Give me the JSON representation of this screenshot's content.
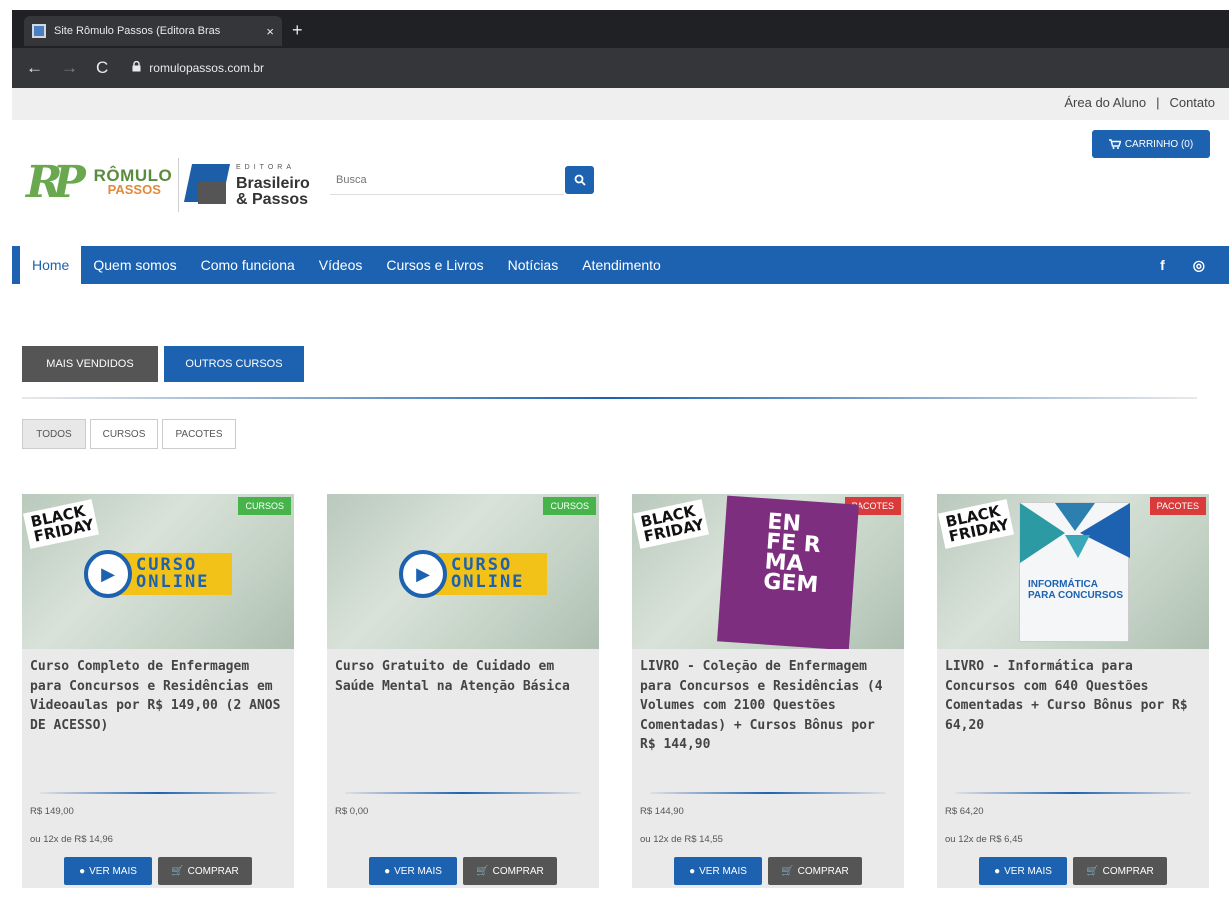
{
  "browser": {
    "tab_title": "Site Rômulo Passos (Editora Bras",
    "tab_close": "×",
    "new_tab": "+",
    "back": "←",
    "forward": "→",
    "reload": "C",
    "url": "romulopassos.com.br"
  },
  "toplinks": {
    "area": "Área do Aluno",
    "separator": "|",
    "contato": "Contato"
  },
  "header": {
    "logo_rr": "RP",
    "logo_name": "RÔMULO",
    "logo_sub": "PASSOS",
    "editora_top": "EDITORA",
    "editora_name1": "Brasileiro",
    "editora_name2": "& Passos",
    "search_placeholder": "Busca",
    "cart_label": "CARRINHO (0)"
  },
  "nav": {
    "items": [
      "Home",
      "Quem somos",
      "Como funciona",
      "Vídeos",
      "Cursos e Livros",
      "Notícias",
      "Atendimento"
    ],
    "facebook": "f",
    "instagram": "◎"
  },
  "section_tabs": {
    "mais_vendidos": "MAIS VENDIDOS",
    "outros_cursos": "OUTROS CURSOS"
  },
  "filters": [
    "TODOS",
    "CURSOS",
    "PACOTES"
  ],
  "products": [
    {
      "badge": "CURSOS",
      "black_friday": "BLACK FRIDAY",
      "image_label": "CURSO ONLINE",
      "title": "Curso Completo de Enfermagem para Concursos e Residências em Videoaulas por R$ 149,00 (2 ANOS DE ACESSO)",
      "price": "R$ 149,00",
      "installments": "ou 12x de R$ 14,96",
      "ver_mais": "VER MAIS",
      "comprar": "COMPRAR"
    },
    {
      "badge": "CURSOS",
      "image_label": "CURSO ONLINE",
      "title": "Curso Gratuito de Cuidado em Saúde Mental na Atenção Básica",
      "price": "R$ 0,00",
      "ver_mais": "VER MAIS",
      "comprar": "COMPRAR"
    },
    {
      "badge": "PACOTES",
      "black_friday": "BLACK FRIDAY",
      "image_label": "EN FE R MA GEM",
      "title": "LIVRO - Coleção de Enfermagem para Concursos e Residências (4 Volumes com 2100 Questões Comentadas) + Cursos Bônus por R$ 144,90",
      "price": "R$ 144,90",
      "installments": "ou 12x de R$ 14,55",
      "ver_mais": "VER MAIS",
      "comprar": "COMPRAR"
    },
    {
      "badge": "PACOTES",
      "black_friday": "BLACK FRIDAY",
      "image_label": "INFORMÁTICA PARA CONCURSOS",
      "title": "LIVRO - Informática para Concursos com 640 Questões Comentadas + Curso Bônus por R$ 64,20",
      "price": "R$ 64,20",
      "installments": "ou 12x de R$ 6,45",
      "ver_mais": "VER MAIS",
      "comprar": "COMPRAR"
    }
  ],
  "colors": {
    "brand_blue": "#1c62b0",
    "dark_gray": "#555555",
    "badge_green": "#47b44b",
    "badge_red": "#d93a3a"
  }
}
